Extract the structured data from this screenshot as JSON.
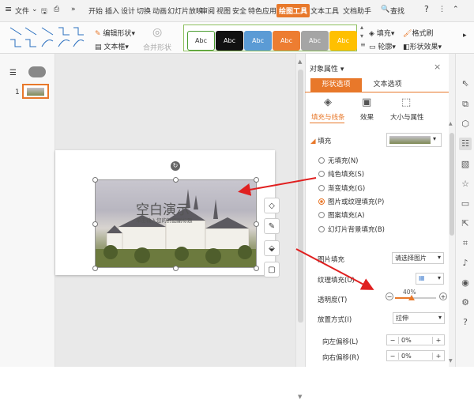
{
  "menubar": {
    "app_menu": "文件",
    "tabs": [
      "开始",
      "插入",
      "设计",
      "切换",
      "动画",
      "幻灯片放映",
      "审阅",
      "视图",
      "安全",
      "特色应用",
      "绘图工具",
      "文本工具",
      "文档助手"
    ],
    "search": "查找",
    "help": "?"
  },
  "ribbon": {
    "edit_shape": "编辑形状",
    "text_box": "文本框",
    "merge_shape": "合并形状",
    "style_samples": [
      "Abc",
      "Abc",
      "Abc",
      "Abc",
      "Abc",
      "Abc"
    ],
    "style_colors": [
      "#ffffff",
      "#111111",
      "#5b9bd5",
      "#ed7d31",
      "#a5a5a5",
      "#ffc000"
    ],
    "fill": "填充",
    "format_painter": "格式刷",
    "outline": "轮廓",
    "shape_effect": "形状效果"
  },
  "slides": {
    "number": "1"
  },
  "slide": {
    "title": "空白演示",
    "subtitle": "单击输入您的封面副标题"
  },
  "pane": {
    "title": "对象属性",
    "tabs": [
      "形状选项",
      "文本选项"
    ],
    "subtabs": [
      "填充与线条",
      "效果",
      "大小与属性"
    ],
    "section": "填充",
    "fill_options": [
      "无填充(N)",
      "纯色填充(S)",
      "渐变填充(G)",
      "图片或纹理填充(P)",
      "图案填充(A)",
      "幻灯片背景填充(B)"
    ],
    "selected_option": 3,
    "picture_fill_label": "图片填充",
    "picture_fill_value": "请选择图片",
    "texture_label": "纹理填充(U)",
    "transparency_label": "透明度(T)",
    "transparency_value": "40%",
    "transparency_fraction": 0.4,
    "placement_label": "放置方式(I)",
    "placement_value": "拉伸",
    "offset_left_label": "向左偏移(L)",
    "offset_left_value": "0%",
    "offset_right_label": "向右偏移(R)",
    "offset_right_value": "0%"
  }
}
